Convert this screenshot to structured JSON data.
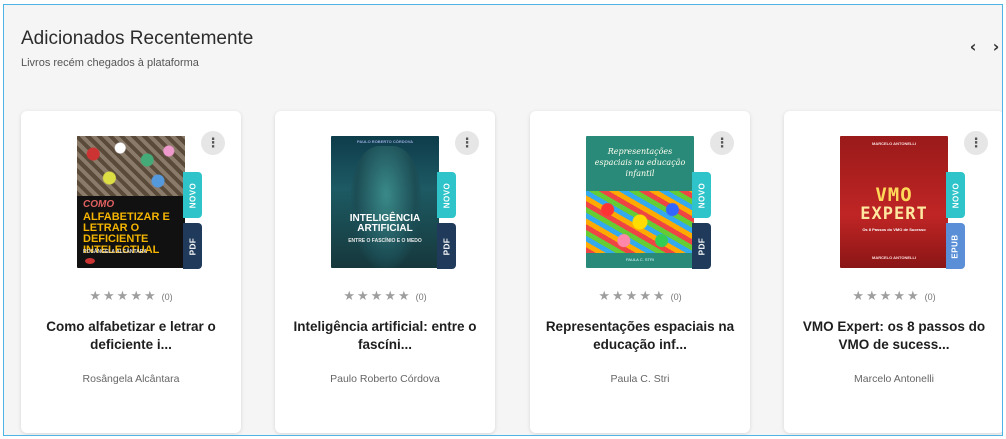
{
  "section": {
    "title": "Adicionados Recentemente",
    "subtitle": "Livros recém chegados à plataforma",
    "prev_icon": "‹",
    "next_icon": "›"
  },
  "menu_icon": "⋮",
  "books": [
    {
      "title": "Como alfabetizar e letrar o deficiente i...",
      "author": "Rosângela Alcântara",
      "badge_new": "NOVO",
      "format": "PDF",
      "format_color": "#1f3a5a",
      "stars": "★★★★★",
      "rating_count": "(0)",
      "cover": {
        "line1": "COMO",
        "line2": "ALFABETIZAR E LETRAR O DEFICIENTE INTELECTUAL",
        "author": "ROSÂNGELA ALCÂNTARA"
      }
    },
    {
      "title": "Inteligência artificial: entre o fascíni...",
      "author": "Paulo Roberto Córdova",
      "badge_new": "NOVO",
      "format": "PDF",
      "format_color": "#1f3a5a",
      "stars": "★★★★★",
      "rating_count": "(0)",
      "cover": {
        "top": "PAULO ROBERTO CÓRDOVA",
        "line1": "INTELIGÊNCIA ARTIFICIAL",
        "line2": "ENTRE O FASCÍNIO E O MEDO"
      }
    },
    {
      "title": "Representações espaciais na educação inf...",
      "author": "Paula C. Stri",
      "badge_new": "NOVO",
      "format": "PDF",
      "format_color": "#1f3a5a",
      "stars": "★★★★★",
      "rating_count": "(0)",
      "cover": {
        "line1": "Representações espaciais na educação infantil",
        "author": "PAULA C. STRI"
      }
    },
    {
      "title": "VMO Expert: os 8 passos do VMO de sucess...",
      "author": "Marcelo Antonelli",
      "badge_new": "NOVO",
      "format": "EPUB",
      "format_color": "#5a8fd8",
      "stars": "★★★★★",
      "rating_count": "(0)",
      "cover": {
        "top": "MARCELO ANTONELLI",
        "line1": "VMO",
        "line2": "EXPERT",
        "line3": "Os 8 Passos do VMO de Sucesso",
        "publisher": "MARCELO ANTONELLI"
      }
    }
  ]
}
